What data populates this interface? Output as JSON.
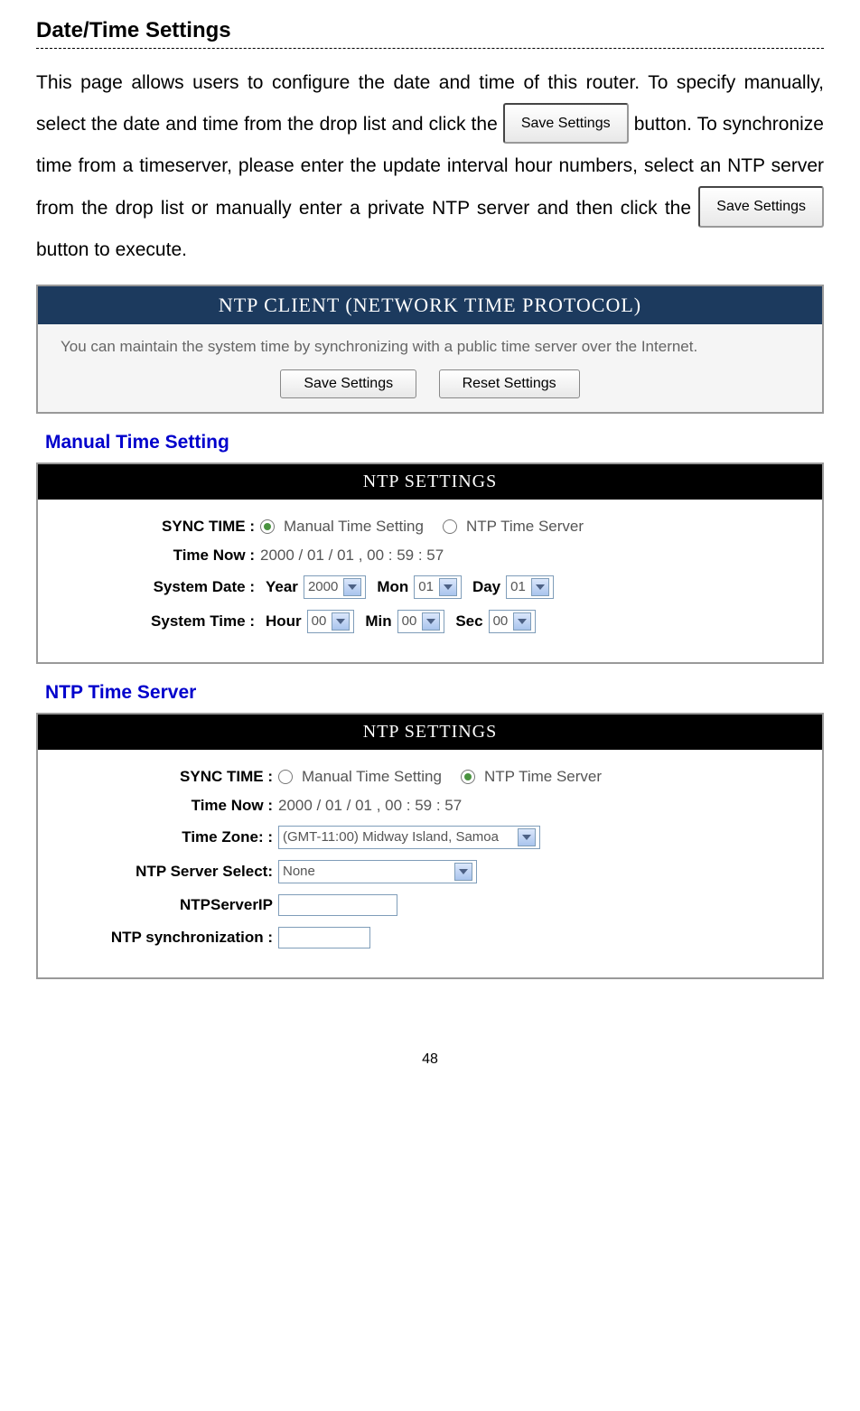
{
  "page": {
    "title": "Date/Time Settings",
    "intro_1": "This page allows users to configure the date and time of this router. To specify manually, select the date and time from the drop list and click the",
    "intro_2": "button. To synchronize time from a timeserver, please enter the update interval hour numbers, select an NTP server from the drop list or manually enter a private NTP server and then click the",
    "intro_3": "button to execute.",
    "save_button_label": "Save Settings",
    "page_number": "48"
  },
  "ntp_client_panel": {
    "title": "NTP CLIENT (NETWORK TIME PROTOCOL)",
    "description": "You can maintain the system time by synchronizing with a public time server over the Internet.",
    "save_button": "Save Settings",
    "reset_button": "Reset Settings"
  },
  "manual_section": {
    "heading": "Manual Time Setting",
    "panel_title": "NTP SETTINGS",
    "rows": {
      "sync_time_label": "SYNC TIME :",
      "sync_manual": "Manual Time Setting",
      "sync_ntp": "NTP Time Server",
      "time_now_label": "Time Now :",
      "time_now_value": "2000 / 01 / 01 , 00 : 59 : 57",
      "system_date_label": "System Date :",
      "year_label": "Year",
      "year_value": "2000",
      "mon_label": "Mon",
      "mon_value": "01",
      "day_label": "Day",
      "day_value": "01",
      "system_time_label": "System Time :",
      "hour_label": "Hour",
      "hour_value": "00",
      "min_label": "Min",
      "min_value": "00",
      "sec_label": "Sec",
      "sec_value": "00"
    }
  },
  "ntp_section": {
    "heading": "NTP Time Server",
    "panel_title": "NTP SETTINGS",
    "rows": {
      "sync_time_label": "SYNC TIME :",
      "sync_manual": "Manual Time Setting",
      "sync_ntp": "NTP Time Server",
      "time_now_label": "Time Now :",
      "time_now_value": "2000 / 01 / 01 , 00 : 59 : 57",
      "time_zone_label": "Time Zone: :",
      "time_zone_value": "(GMT-11:00) Midway Island, Samoa",
      "ntp_select_label": "NTP Server Select:",
      "ntp_select_value": "None",
      "ntp_ip_label": "NTPServerIP",
      "ntp_sync_label": "NTP synchronization :"
    }
  }
}
